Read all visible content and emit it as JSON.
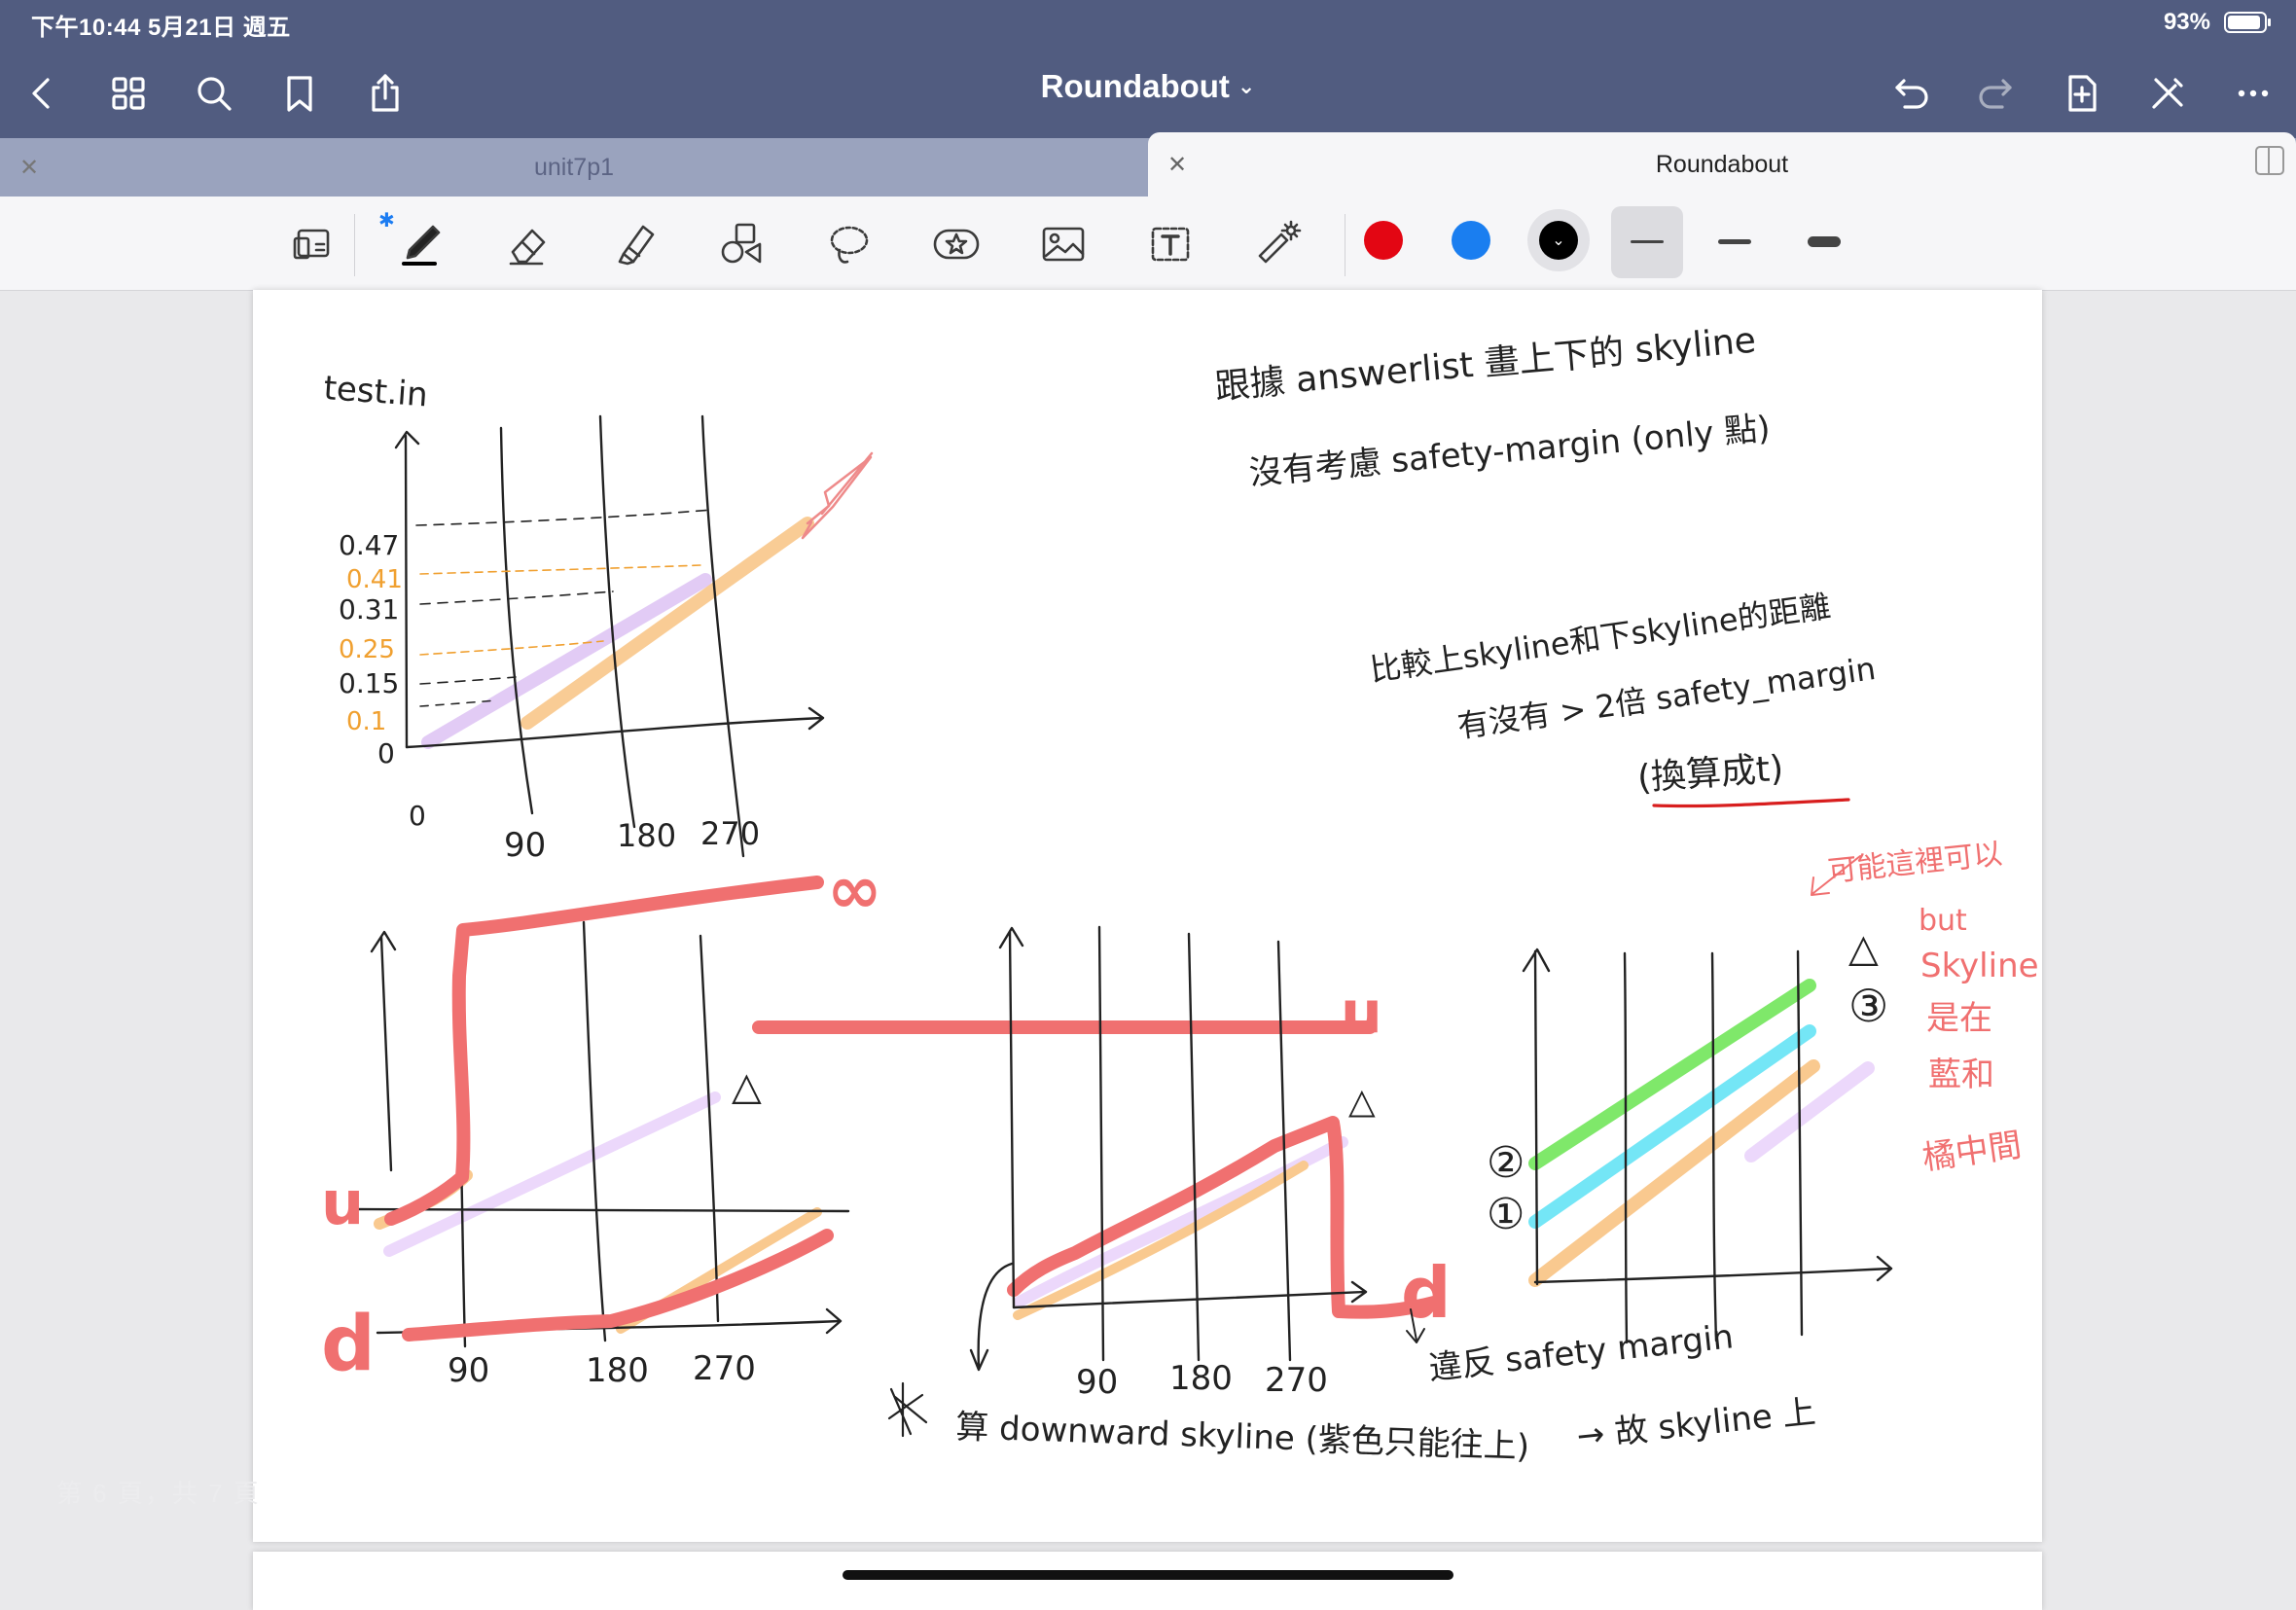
{
  "status": {
    "time": "下午10:44  5月21日 週五",
    "battery": "93%",
    "battery_level": 0.93
  },
  "nav": {
    "title": "Roundabout",
    "caret": "⌄"
  },
  "tabs": [
    {
      "label": "unit7p1",
      "active": false
    },
    {
      "label": "Roundabout",
      "active": true
    }
  ],
  "toolbar": {
    "tools": [
      "page-thumbnail",
      "pen",
      "eraser",
      "highlighter",
      "shapes",
      "lasso",
      "sticker",
      "image",
      "text",
      "laser-pointer"
    ],
    "colors": {
      "red": "#e30613",
      "blue": "#1a7ef0",
      "black": "#000000"
    },
    "selected_color": "black",
    "bluetooth_icon": "bluetooth-icon"
  },
  "notes": {
    "test_label": "test.in",
    "yticks": [
      "0.47",
      "0.41",
      "0.31",
      "0.25",
      "0.15",
      "0.1",
      "0"
    ],
    "xticks": [
      "0",
      "90",
      "180",
      "270"
    ],
    "top_right_1": "跟據 answerlist 畫上下的 skyline",
    "top_right_2": "沒有考慮 safety-margin (only 點)",
    "mid_right_1": "比較上skyline和下skyline的距離",
    "mid_right_2": "有沒有 > 2倍 safety_margin",
    "mid_right_3": "(換算成t)",
    "label_u": "u",
    "label_d": "d",
    "label_inf": "∞",
    "label_tri": "△",
    "bottom_xticks": [
      "90",
      "180",
      "270"
    ],
    "bottom_note": "算 downward skyline (紫色只能往上)",
    "mid_note_1": "違反 safety margin",
    "mid_note_2": "→ 故 skyline 上",
    "side_1": "可能這裡可以",
    "side_2": "but",
    "side_3": "Skyline",
    "side_4": "是在",
    "side_5": "藍和",
    "side_6": "橘中間",
    "label_2": "②",
    "label_1": "①",
    "label_3": "③"
  },
  "page_footer": "第 6 頁，共 7 頁"
}
